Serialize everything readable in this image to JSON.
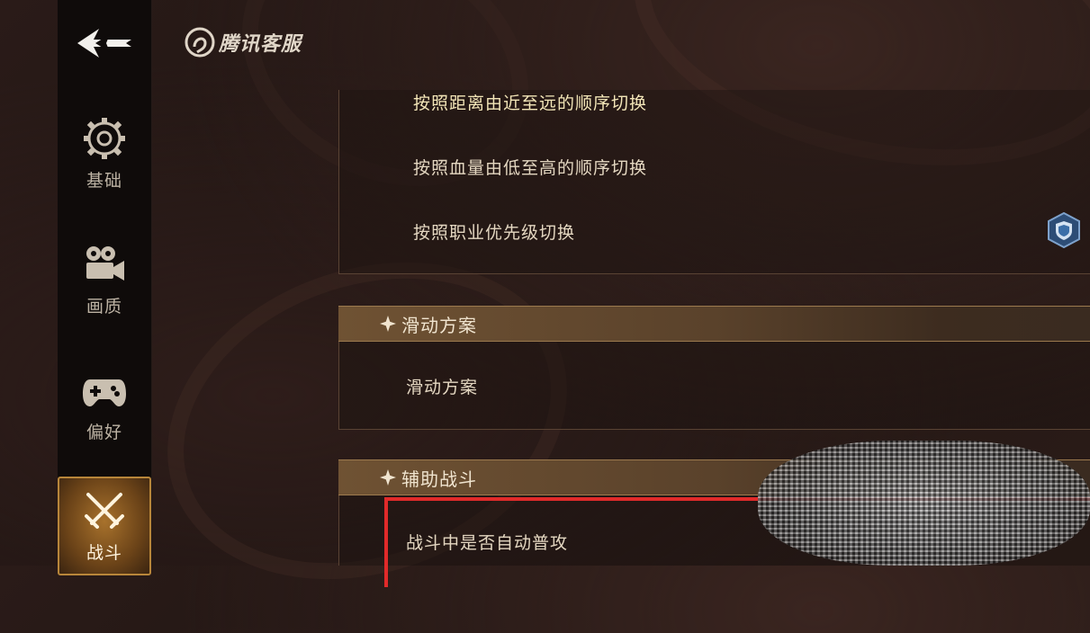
{
  "brand": {
    "logo_text": "腾讯客服"
  },
  "sidebar": {
    "items": [
      {
        "label": "基础",
        "icon": "gear-icon"
      },
      {
        "label": "画质",
        "icon": "camera-icon"
      },
      {
        "label": "偏好",
        "icon": "gamepad-icon"
      },
      {
        "label": "战斗",
        "icon": "crossed-swords-icon",
        "active": true
      }
    ]
  },
  "target_switch": {
    "options": [
      "按照距离由近至远的顺序切换",
      "按照血量由低至高的顺序切换",
      "按照职业优先级切换"
    ]
  },
  "sections": {
    "swipe": {
      "title": "滑动方案",
      "option": "滑动方案"
    },
    "assist": {
      "title": "辅助战斗",
      "option": "战斗中是否自动普攻"
    }
  },
  "colors": {
    "accent_gold": "#b8863a",
    "highlight_red": "#e12a2a",
    "shield_blue": "#3c6fa8"
  }
}
